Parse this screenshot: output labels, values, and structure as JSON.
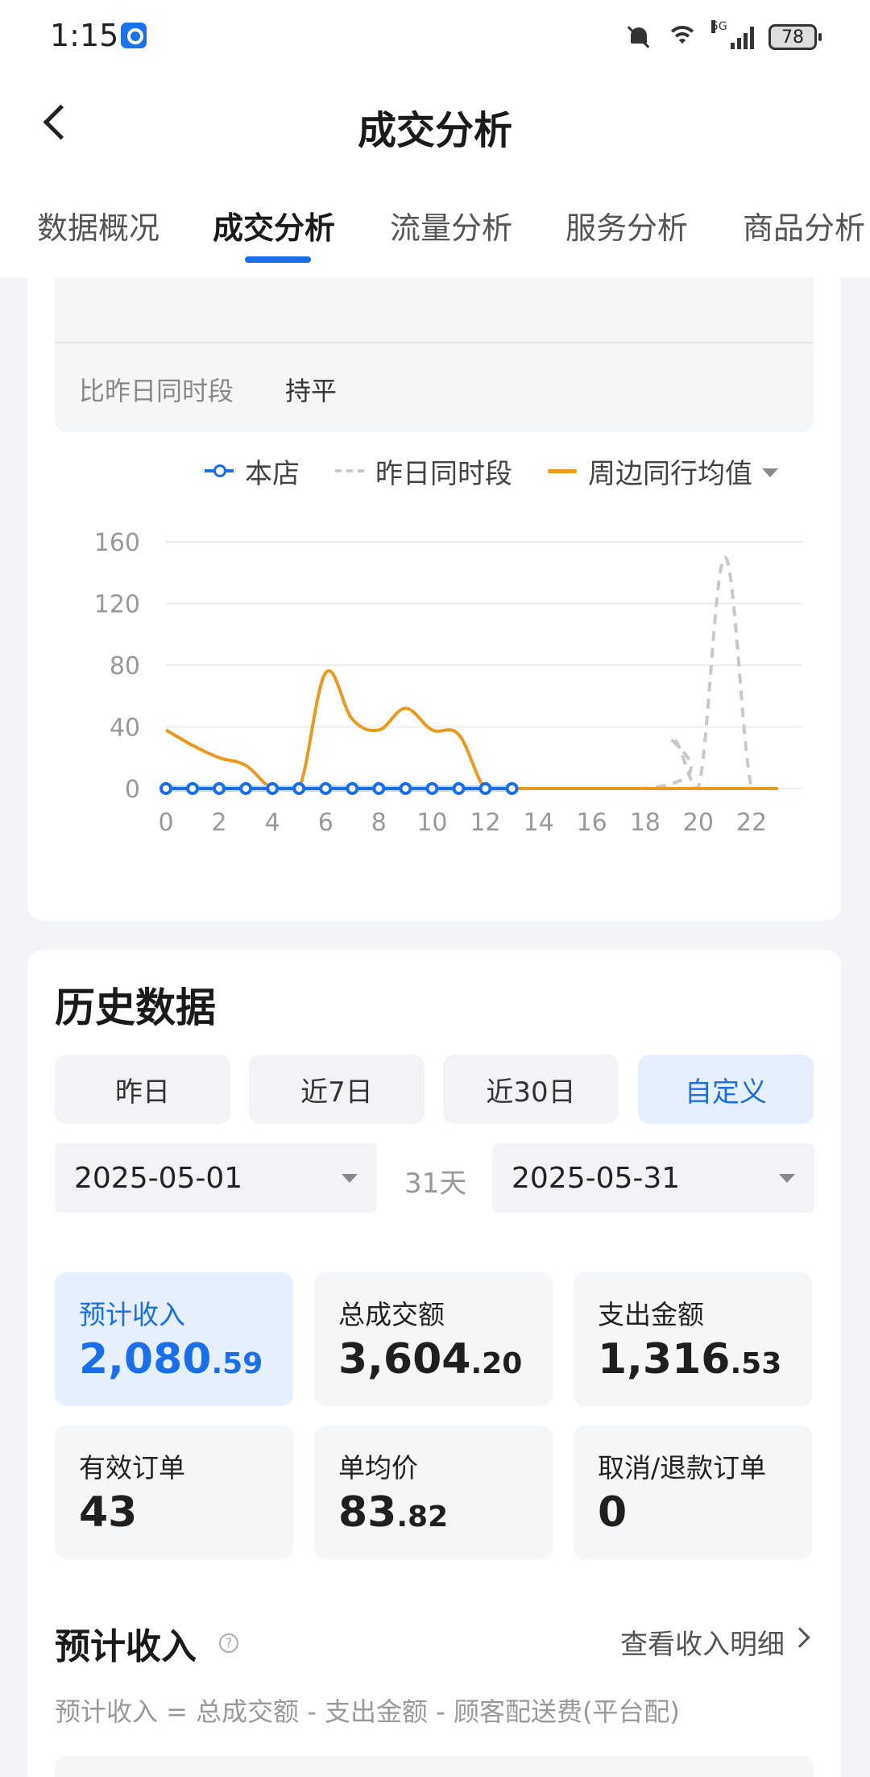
{
  "status_bar": {
    "time": "1:15",
    "battery": "78",
    "network": "5G"
  },
  "header": {
    "title": "成交分析"
  },
  "tabs": [
    "数据概况",
    "成交分析",
    "流量分析",
    "服务分析",
    "商品分析"
  ],
  "active_tab": 1,
  "comparison": {
    "label": "比昨日同时段",
    "value": "持平"
  },
  "legend": {
    "store": "本店",
    "yesterday": "昨日同时段",
    "peers": "周边同行均值"
  },
  "colors": {
    "accent": "#1a6ee8",
    "peers_line": "#ea9a1f",
    "yesterday_line": "#c8c8c8"
  },
  "chart_data": {
    "type": "line",
    "x_ticks": [
      "0",
      "2",
      "4",
      "6",
      "8",
      "10",
      "12",
      "14",
      "16",
      "18",
      "20",
      "22"
    ],
    "y_ticks": [
      "0",
      "40",
      "80",
      "120",
      "160"
    ],
    "ylim": [
      0,
      160
    ],
    "xlim": [
      0,
      23
    ],
    "grid": true,
    "legend_position": "top-right",
    "series": [
      {
        "name": "本店",
        "style": "line-with-markers",
        "x": [
          0,
          1,
          2,
          3,
          4,
          5,
          6,
          7,
          8,
          9,
          10,
          11,
          12,
          13
        ],
        "y": [
          0,
          0,
          0,
          0,
          0,
          0,
          0,
          0,
          0,
          0,
          0,
          0,
          0,
          0
        ]
      },
      {
        "name": "昨日同时段",
        "style": "dashed",
        "x": [
          0,
          18,
          19,
          20,
          21,
          22,
          23
        ],
        "y": [
          0,
          0,
          33,
          0,
          150,
          0,
          0
        ]
      },
      {
        "name": "周边同行均值",
        "style": "smooth",
        "x": [
          0,
          1,
          2,
          3,
          4,
          5,
          6,
          7,
          8,
          9,
          10,
          11,
          12,
          13,
          23
        ],
        "y": [
          38,
          28,
          20,
          15,
          0,
          0,
          75,
          45,
          38,
          52,
          38,
          35,
          0,
          0,
          0
        ]
      }
    ]
  },
  "history": {
    "title": "历史数据",
    "ranges": [
      "昨日",
      "近7日",
      "近30日",
      "自定义"
    ],
    "active_range": 3,
    "start_date": "2025-05-01",
    "end_date": "2025-05-31",
    "days": "31天",
    "stats": [
      {
        "label": "预计收入",
        "int": "2,080",
        "dec": ".59"
      },
      {
        "label": "总成交额",
        "int": "3,604",
        "dec": ".20"
      },
      {
        "label": "支出金额",
        "int": "1,316",
        "dec": ".53"
      },
      {
        "label": "有效订单",
        "int": "43",
        "dec": ""
      },
      {
        "label": "单均价",
        "int": "83",
        "dec": ".82"
      },
      {
        "label": "取消/退款订单",
        "int": "0",
        "dec": ""
      }
    ]
  },
  "income": {
    "title": "预计收入",
    "help": "?",
    "detail_link": "查看收入明细",
    "formula": "预计收入 = 总成交额 - 支出金额 - 顾客配送费(平台配)"
  }
}
